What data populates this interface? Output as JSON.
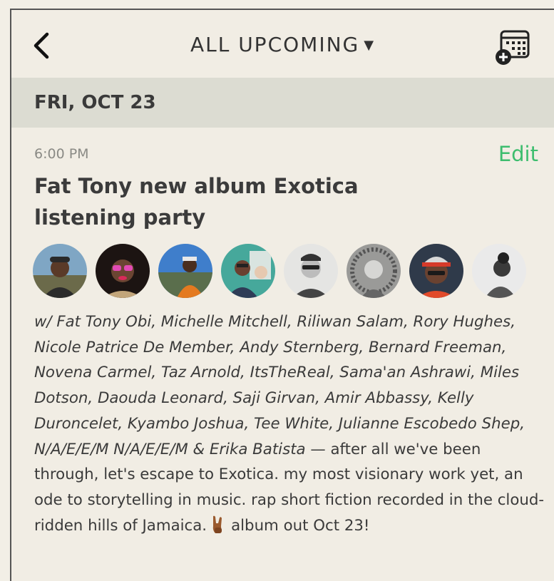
{
  "topbar": {
    "title": "ALL UPCOMING",
    "caret": "▼",
    "back_icon": "chevron-left-icon",
    "calendar_icon": "calendar-add-icon"
  },
  "date_header": "FRI, OCT 23",
  "event": {
    "time": "6:00 PM",
    "edit_label": "Edit",
    "title": "Fat Tony new album Exotica listening party",
    "guests_text": "w/ Fat Tony Obi, Michelle Mitchell, Riliwan Salam, Rory Hughes, Nicole Patrice De Member, Andy Sternberg, Bernard Freeman, Novena Carmel, Taz Arnold, ItsTheReal, Sama'an Ashrawi, Miles Dotson, Daouda Leonard, Saji Girvan, Amir Abbassy, Kelly Duroncelet, Kyambo Joshua, Tee White, Julianne Escobedo Shep, N/A/E/E/M N/A/E/E/M & Erika Batista",
    "description": " — after all we've been through, let's escape to Exotica. my most visionary work yet, an ode to storytelling in music. rap short fiction recorded in the cloud-ridden hills of Jamaica.",
    "emoji": "rock-on-hand-icon",
    "description_end": "album out Oct 23!",
    "avatar_count": 8
  },
  "colors": {
    "accent_green": "#3dbd6e",
    "background": "#f1ede4",
    "date_header_bg": "#dcdcd2"
  }
}
